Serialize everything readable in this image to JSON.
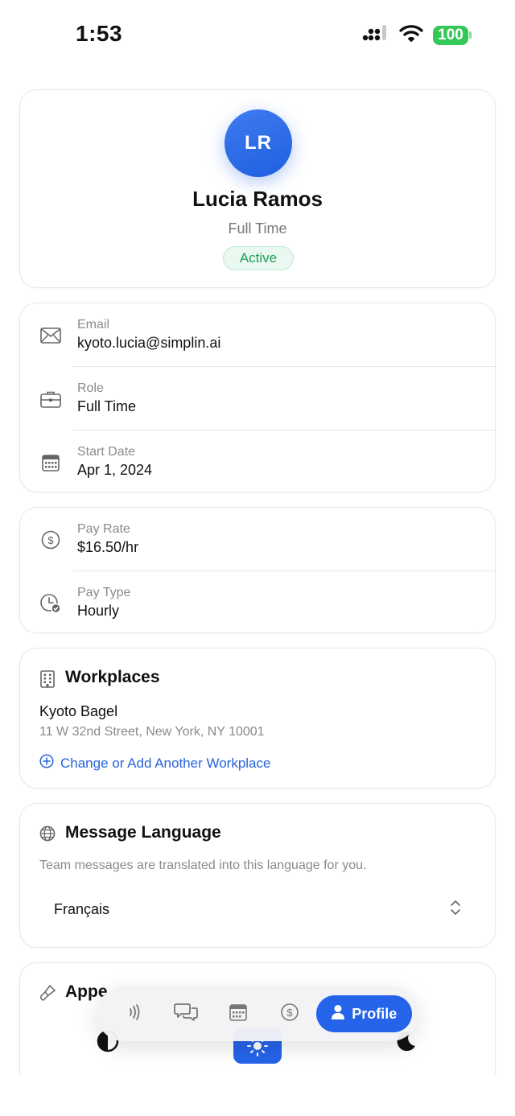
{
  "status_bar": {
    "time": "1:53",
    "battery": "100"
  },
  "profile": {
    "initials": "LR",
    "name": "Lucia Ramos",
    "employment_type": "Full Time",
    "status": "Active"
  },
  "contact": [
    {
      "label": "Email",
      "value": "kyoto.lucia@simplin.ai",
      "icon": "envelope-icon"
    },
    {
      "label": "Role",
      "value": "Full Time",
      "icon": "briefcase-icon"
    },
    {
      "label": "Start Date",
      "value": "Apr 1, 2024",
      "icon": "calendar-icon"
    }
  ],
  "pay": [
    {
      "label": "Pay Rate",
      "value": "$16.50/hr",
      "icon": "dollar-icon"
    },
    {
      "label": "Pay Type",
      "value": "Hourly",
      "icon": "clock-check-icon"
    }
  ],
  "workplaces": {
    "title": "Workplaces",
    "name": "Kyoto Bagel",
    "address": "11 W 32nd Street, New York, NY 10001",
    "link": "Change or Add Another Workplace"
  },
  "language": {
    "title": "Message Language",
    "description": "Team messages are translated into this language for you.",
    "selected": "Français"
  },
  "appearance": {
    "title": "Appe"
  },
  "tabbar": {
    "active_label": "Profile"
  },
  "colors": {
    "accent": "#2563e8",
    "active_green": "#1e9f5b",
    "link": "#2563d9"
  }
}
